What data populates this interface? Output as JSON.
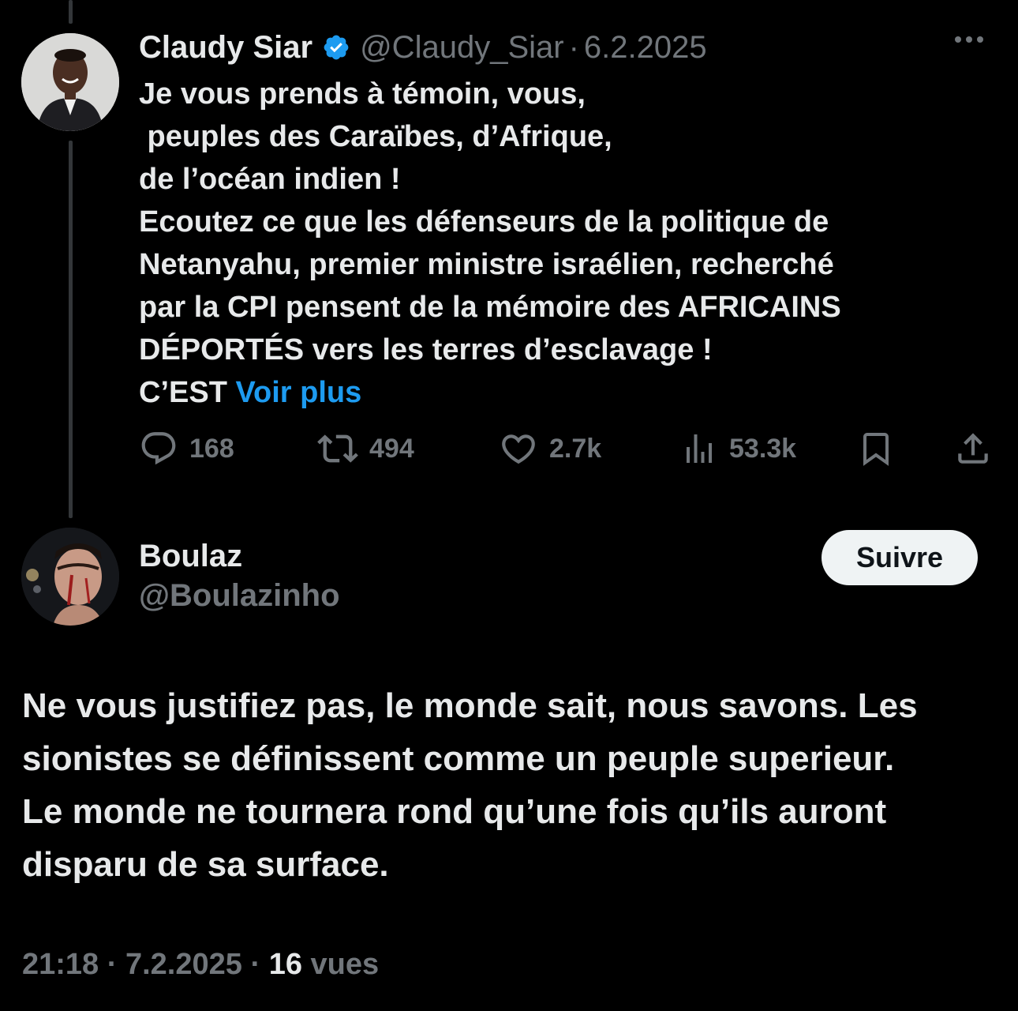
{
  "parent_tweet": {
    "display_name": "Claudy Siar",
    "handle": "@Claudy_Siar",
    "separator": "·",
    "date": "6.2.2025",
    "text_lines": [
      "Je vous prends à témoin, vous,",
      " peuples des Caraïbes, d’Afrique,",
      "de l’océan indien !",
      "Ecoutez ce que les défenseurs de la politique de",
      "Netanyahu, premier ministre israélien, recherché",
      "par la CPI pensent de la mémoire des AFRICAINS",
      "DÉPORTÉS vers les terres d’esclavage !"
    ],
    "last_line_prefix": "C’EST ",
    "see_more": "Voir plus",
    "actions": {
      "replies": "168",
      "reposts": "494",
      "likes": "2.7k",
      "views": "53.3k"
    }
  },
  "reply": {
    "display_name": "Boulaz",
    "handle": "@Boulazinho",
    "follow_label": "Suivre",
    "text_lines": [
      "Ne vous justifiez pas, le monde sait, nous savons. Les",
      "sionistes se définissent comme un peuple superieur.",
      "Le monde ne tournera rond qu’une fois qu’ils auront",
      "disparu de sa surface."
    ],
    "time": "21:18",
    "separator": "·",
    "date": "7.2.2025",
    "views_count": "16",
    "views_label": "vues"
  },
  "colors": {
    "background": "#000000",
    "text": "#e7e9ea",
    "secondary": "#71767b",
    "accent": "#1d9bf0",
    "follow_bg": "#eff3f4"
  }
}
